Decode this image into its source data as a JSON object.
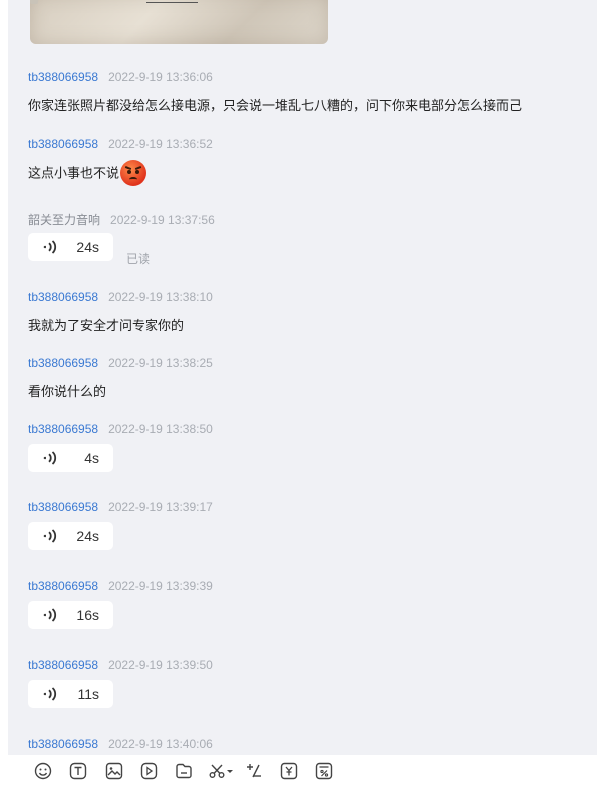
{
  "messages": [
    {
      "sender": "tb388066958",
      "time": "2022-9-19 13:36:06",
      "type": "text",
      "text": "你家连张照片都没给怎么接电源，只会说一堆乱七八糟的，问下你来电部分怎么接而己"
    },
    {
      "sender": "tb388066958",
      "time": "2022-9-19 13:36:52",
      "type": "text",
      "text": "这点小事也不说",
      "emoji": "angry-face"
    },
    {
      "sender": "韶关至力音响",
      "time": "2022-9-19 13:37:56",
      "type": "voice",
      "duration": "24s",
      "status": "已读"
    },
    {
      "sender": "tb388066958",
      "time": "2022-9-19 13:38:10",
      "type": "text",
      "text": "我就为了安全才问专家你的"
    },
    {
      "sender": "tb388066958",
      "time": "2022-9-19 13:38:25",
      "type": "text",
      "text": "看你说什么的"
    },
    {
      "sender": "tb388066958",
      "time": "2022-9-19 13:38:50",
      "type": "voice",
      "duration": "4s"
    },
    {
      "sender": "tb388066958",
      "time": "2022-9-19 13:39:17",
      "type": "voice",
      "duration": "24s"
    },
    {
      "sender": "tb388066958",
      "time": "2022-9-19 13:39:39",
      "type": "voice",
      "duration": "16s"
    },
    {
      "sender": "tb388066958",
      "time": "2022-9-19 13:39:50",
      "type": "voice",
      "duration": "11s"
    },
    {
      "sender": "tb388066958",
      "time": "2022-9-19 13:40:06",
      "type": "partial"
    }
  ],
  "colors": {
    "sender_buyer": "#3a79d2",
    "sender_seller": "#888c94",
    "timestamp": "#a8acb3",
    "chat_bg": "#f0f1f5",
    "bubble_bg": "#ffffff"
  },
  "toolbar": {
    "icons": [
      "emoji-icon",
      "text-format-icon",
      "image-icon",
      "video-icon",
      "file-icon",
      "scissors-icon",
      "dropdown-arrow-icon",
      "quick-phrase-icon",
      "coupon-icon",
      "discount-icon"
    ]
  }
}
